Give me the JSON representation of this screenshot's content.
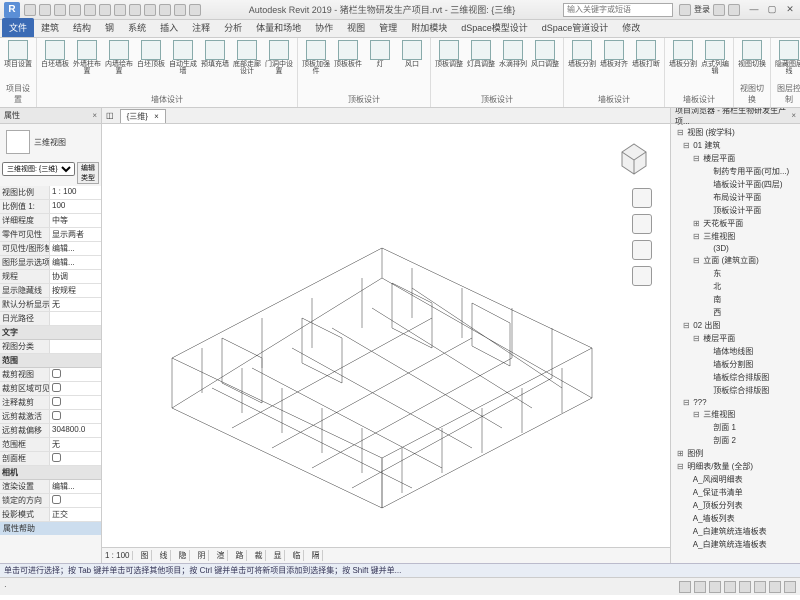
{
  "app": {
    "logo": "R",
    "title": "Autodesk Revit 2019 - 猪栏生物研发生产项目.rvt - 三维视图: {三维}",
    "search_placeholder": "输入关键字或短语",
    "user_label": "登录"
  },
  "tabs": [
    "文件",
    "建筑",
    "结构",
    "钢",
    "系统",
    "插入",
    "注释",
    "分析",
    "体量和场地",
    "协作",
    "视图",
    "管理",
    "附加模块",
    "dSpace模型设计",
    "dSpace管道设计",
    "修改"
  ],
  "active_tab": 0,
  "ribbon": [
    {
      "title": "项目设置",
      "buttons": [
        {
          "label": "项目设置"
        }
      ]
    },
    {
      "title": "墙体设计",
      "buttons": [
        {
          "label": "白坯墙板"
        },
        {
          "label": "外墙柱布置"
        },
        {
          "label": "内墙绘布置"
        },
        {
          "label": "白坯顶板"
        },
        {
          "label": "自动生成墙"
        },
        {
          "label": "预填充墙"
        },
        {
          "label": "底部走廊设计"
        },
        {
          "label": "门洞中设置"
        }
      ]
    },
    {
      "title": "顶板设计",
      "buttons": [
        {
          "label": "顶板加强件"
        },
        {
          "label": "顶板板件"
        },
        {
          "label": "灯"
        },
        {
          "label": "风口"
        }
      ]
    },
    {
      "title": "顶板设计",
      "buttons": [
        {
          "label": "顶板调整"
        },
        {
          "label": "灯具调整"
        },
        {
          "label": "水滴排列"
        },
        {
          "label": "风口调整"
        }
      ]
    },
    {
      "title": "墙板设计",
      "buttons": [
        {
          "label": "墙板分割"
        },
        {
          "label": "墙板对齐"
        },
        {
          "label": "墙板打断"
        }
      ]
    },
    {
      "title": "墙板设计",
      "buttons": [
        {
          "label": "墙板分割"
        },
        {
          "label": "点式列编辑"
        }
      ]
    },
    {
      "title": "视图切换",
      "buttons": [
        {
          "label": "视图切换"
        }
      ]
    },
    {
      "title": "图层控制",
      "buttons": [
        {
          "label": "隐藏图层线"
        }
      ]
    }
  ],
  "properties": {
    "panel_title": "属性",
    "view_type": "三维视图",
    "filter_label": "三维视图: {三维}",
    "edit_type": "编辑类型",
    "sections": [
      {
        "label": "视图比例",
        "value": "1 : 100"
      },
      {
        "label": "比例值 1:",
        "value": "100"
      },
      {
        "label": "详细程度",
        "value": "中等"
      },
      {
        "label": "零件可见性",
        "value": "显示两者"
      },
      {
        "label": "可见性/图形替换",
        "value": "编辑..."
      },
      {
        "label": "图形显示选项",
        "value": "编辑..."
      },
      {
        "label": "规程",
        "value": "协调"
      },
      {
        "label": "显示隐藏线",
        "value": "按规程"
      },
      {
        "label": "默认分析显示...",
        "value": "无"
      },
      {
        "label": "日光路径",
        "value": ""
      }
    ],
    "text_section": "文字",
    "text_rows": [
      {
        "label": "视图分类",
        "value": ""
      }
    ],
    "extent_section": "范围",
    "extent_rows": [
      {
        "label": "裁剪视图",
        "value": "false",
        "cb": true
      },
      {
        "label": "裁剪区域可见",
        "value": "false",
        "cb": true
      },
      {
        "label": "注释裁剪",
        "value": "false",
        "cb": true
      },
      {
        "label": "远剪裁激活",
        "value": "false",
        "cb": true
      },
      {
        "label": "远剪裁偏移",
        "value": "304800.0"
      },
      {
        "label": "范围框",
        "value": "无"
      },
      {
        "label": "剖面框",
        "value": "false",
        "cb": true
      }
    ],
    "camera_section": "相机",
    "camera_rows": [
      {
        "label": "渲染设置",
        "value": "编辑..."
      },
      {
        "label": "锁定的方向",
        "value": "false",
        "cb": true
      },
      {
        "label": "投影模式",
        "value": "正交"
      }
    ],
    "help_label": "属性帮助"
  },
  "canvas": {
    "tab_label": "{三维}",
    "close": "×"
  },
  "browser": {
    "title": "项目浏览器 - 猪栏生物研发生产项...",
    "tree": [
      {
        "l": 0,
        "t": "⊟",
        "label": "视图 (按学科)"
      },
      {
        "l": 1,
        "t": "⊟",
        "label": "01 建筑"
      },
      {
        "l": 2,
        "t": "⊟",
        "label": "楼层平面"
      },
      {
        "l": 3,
        "t": "",
        "label": "制药专用平面(可加...)"
      },
      {
        "l": 3,
        "t": "",
        "label": "墙板设计平面(四层)"
      },
      {
        "l": 3,
        "t": "",
        "label": "布局设计平面"
      },
      {
        "l": 3,
        "t": "",
        "label": "顶板设计平面"
      },
      {
        "l": 2,
        "t": "⊞",
        "label": "天花板平面"
      },
      {
        "l": 2,
        "t": "⊟",
        "label": "三维视图"
      },
      {
        "l": 3,
        "t": "",
        "label": "(3D)"
      },
      {
        "l": 2,
        "t": "⊟",
        "label": "立面 (建筑立面)"
      },
      {
        "l": 3,
        "t": "",
        "label": "东"
      },
      {
        "l": 3,
        "t": "",
        "label": "北"
      },
      {
        "l": 3,
        "t": "",
        "label": "南"
      },
      {
        "l": 3,
        "t": "",
        "label": "西"
      },
      {
        "l": 1,
        "t": "⊟",
        "label": "02 出图"
      },
      {
        "l": 2,
        "t": "⊟",
        "label": "楼层平面"
      },
      {
        "l": 3,
        "t": "",
        "label": "墙体地线图"
      },
      {
        "l": 3,
        "t": "",
        "label": "墙板分割图"
      },
      {
        "l": 3,
        "t": "",
        "label": "墙板综合排版图"
      },
      {
        "l": 3,
        "t": "",
        "label": "顶板综合排版图"
      },
      {
        "l": 1,
        "t": "⊟",
        "label": "???"
      },
      {
        "l": 2,
        "t": "⊟",
        "label": "三维视图"
      },
      {
        "l": 3,
        "t": "",
        "label": "剖面 1"
      },
      {
        "l": 3,
        "t": "",
        "label": "剖面 2"
      },
      {
        "l": 0,
        "t": "⊞",
        "label": "图例"
      },
      {
        "l": 0,
        "t": "⊟",
        "label": "明细表/数量 (全部)"
      },
      {
        "l": 1,
        "t": "",
        "label": "A_风阀明细表"
      },
      {
        "l": 1,
        "t": "",
        "label": "A_保证书清单"
      },
      {
        "l": 1,
        "t": "",
        "label": "A_顶板分列表"
      },
      {
        "l": 1,
        "t": "",
        "label": "A_墙板列表"
      },
      {
        "l": 1,
        "t": "",
        "label": "A_白建筑统连墙板表"
      },
      {
        "l": 1,
        "t": "",
        "label": "A_白建筑统连墙板表"
      }
    ]
  },
  "viewbar": {
    "scale": "1 : 100",
    "items": [
      "图",
      "线",
      "隐",
      "阴",
      "渲",
      "路",
      "裁",
      "显",
      "临",
      "隔"
    ]
  },
  "hint": "单击可进行选择；按 Tab 键并单击可选择其他项目；按 Ctrl 键并单击可将新项目添加到选择集；按 Shift 键并单...",
  "status_right_icons": 8
}
